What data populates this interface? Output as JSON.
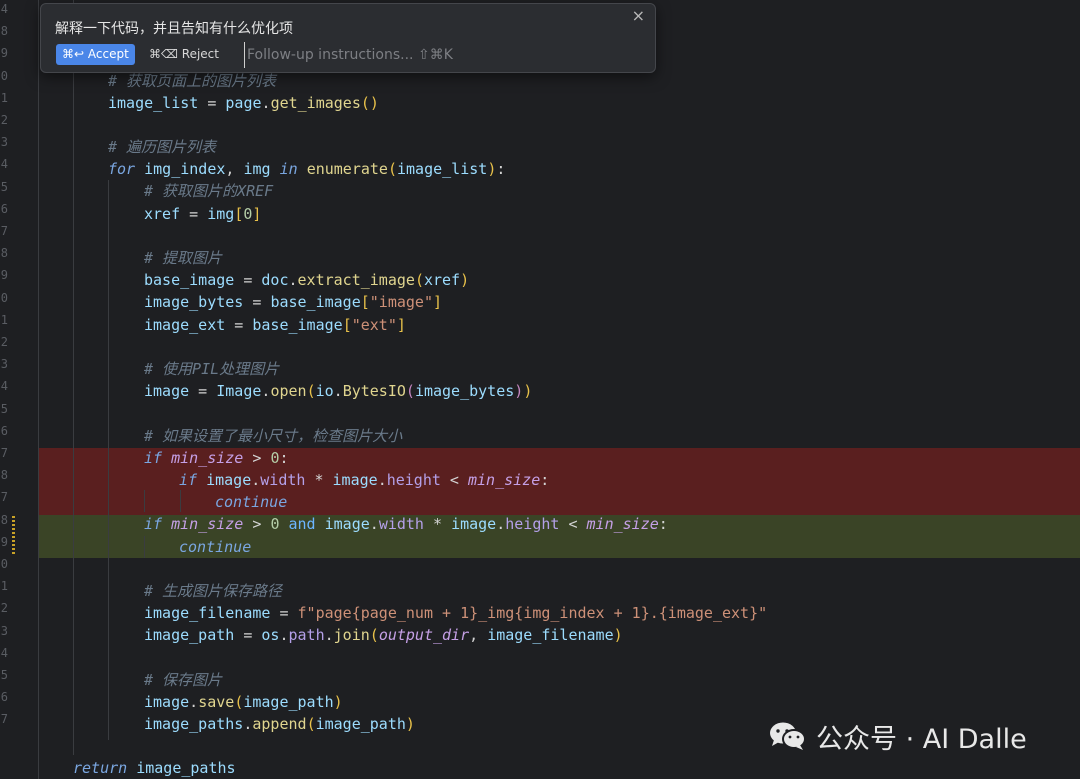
{
  "popup": {
    "title": "解释一下代码，并且告知有什么优化项",
    "accept_label": "⌘↩ Accept",
    "reject_label": "⌘⌫ Reject",
    "followup_placeholder": "Follow-up instructions... ⇧⌘K"
  },
  "gutter": {
    "numbers": [
      "4",
      "8",
      "9",
      "0",
      "1",
      "2",
      "3",
      "4",
      "5",
      "6",
      "7",
      "8",
      "9",
      "0",
      "1",
      "2",
      "3",
      "4",
      "5",
      "6",
      "7",
      "8",
      "7",
      "8",
      "9",
      "0",
      "1",
      "2",
      "3",
      "4",
      "5",
      "6",
      "7"
    ]
  },
  "code": {
    "comment_get_images": "# 获取页面上的图片列表",
    "image_list": "image_list",
    "page": "page",
    "get_images": "get_images",
    "comment_loop": "# 遍历图片列表",
    "kw_for": "for",
    "img_index": "img_index",
    "img": "img",
    "kw_in": "in",
    "enumerate": "enumerate",
    "comment_xref": "# 获取图片的XREF",
    "xref": "xref",
    "zero": "0",
    "comment_extract": "# 提取图片",
    "base_image": "base_image",
    "doc": "doc",
    "extract_image": "extract_image",
    "image_bytes": "image_bytes",
    "str_image": "\"image\"",
    "image_ext": "image_ext",
    "str_ext": "\"ext\"",
    "comment_pil": "# 使用PIL处理图片",
    "image": "image",
    "Image": "Image",
    "open": "open",
    "io": "io",
    "BytesIO": "BytesIO",
    "comment_minsize": "# 如果设置了最小尺寸，检查图片大小",
    "kw_if": "if",
    "min_size": "min_size",
    "width": "width",
    "height": "height",
    "kw_continue": "continue",
    "kw_and": "and",
    "comment_path": "# 生成图片保存路径",
    "image_filename": "image_filename",
    "fstring": "f\"page{page_num + 1}_img{img_index + 1}.{image_ext}\"",
    "image_path": "image_path",
    "os": "os",
    "path": "path",
    "join": "join",
    "output_dir": "output_dir",
    "comment_save": "# 保存图片",
    "save": "save",
    "image_paths": "image_paths",
    "append": "append",
    "kw_return": "return"
  },
  "watermark": {
    "text": "公众号 · AI Dalle",
    "icon": "wechat-icon"
  }
}
